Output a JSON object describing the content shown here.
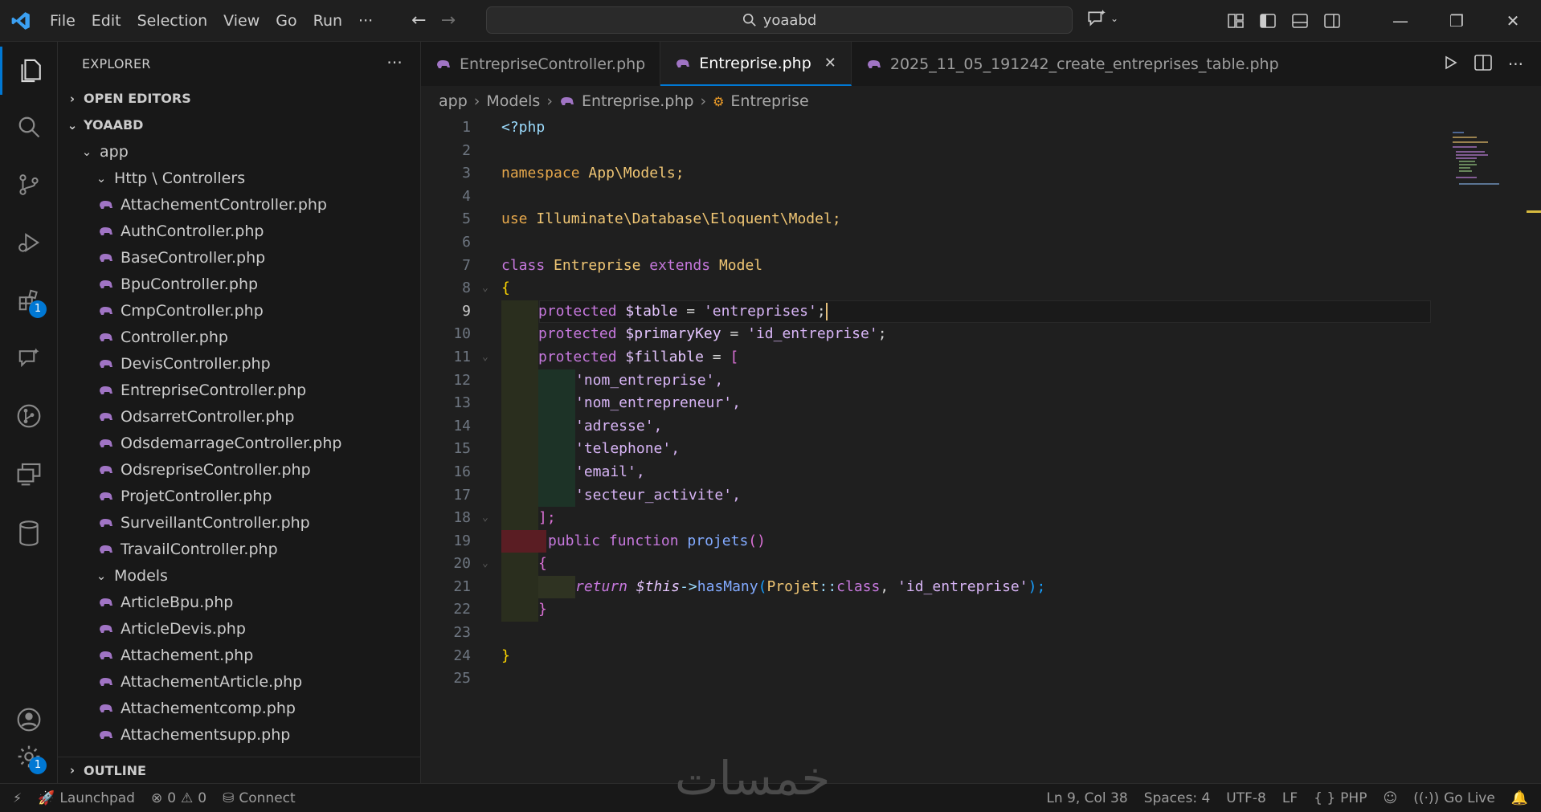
{
  "menu": [
    "File",
    "Edit",
    "Selection",
    "View",
    "Go",
    "Run",
    "···"
  ],
  "search": {
    "text": "yoaabd"
  },
  "explorer": {
    "title": "EXPLORER",
    "open_editors": "OPEN EDITORS",
    "root": "YOAABD",
    "app": "app",
    "http_controllers": "Http \\ Controllers",
    "controllers": [
      "AttachementController.php",
      "AuthController.php",
      "BaseController.php",
      "BpuController.php",
      "CmpController.php",
      "Controller.php",
      "DevisController.php",
      "EntrepriseController.php",
      "OdsarretController.php",
      "OdsdemarrageController.php",
      "OdsrepriseController.php",
      "ProjetController.php",
      "SurveillantController.php",
      "TravailController.php"
    ],
    "models": "Models",
    "model_files": [
      "ArticleBpu.php",
      "ArticleDevis.php",
      "Attachement.php",
      "AttachementArticle.php",
      "Attachementcomp.php",
      "Attachementsupp.php"
    ],
    "outline": "OUTLINE"
  },
  "activity": {
    "extensions_badge": "1",
    "settings_badge": "1"
  },
  "tabs": [
    {
      "label": "EntrepriseController.php"
    },
    {
      "label": "Entreprise.php",
      "close": "✕"
    },
    {
      "label": "2025_11_05_191242_create_entreprises_table.php"
    }
  ],
  "breadcrumb": [
    "app",
    "Models",
    "Entreprise.php",
    "Entreprise"
  ],
  "code": {
    "l1": "<?php",
    "l3a": "namespace",
    "l3b": "App\\Models;",
    "l5a": "use",
    "l5b": "Illuminate\\Database\\Eloquent\\Model;",
    "l7a": "class",
    "l7b": "Entreprise",
    "l7c": "extends",
    "l7d": "Model",
    "l8": "{",
    "l9a": "protected",
    "l9b": "$table",
    "l9c": " = ",
    "l9d": "'entreprises'",
    "l9e": ";",
    "l10a": "protected",
    "l10b": "$primaryKey",
    "l10c": " = ",
    "l10d": "'id_entreprise'",
    "l10e": ";",
    "l11a": "protected",
    "l11b": "$fillable",
    "l11c": " = ",
    "l11d": "[",
    "l12": "'nom_entreprise',",
    "l13": "'nom_entrepreneur',",
    "l14": "'adresse',",
    "l15": "'telephone',",
    "l16": "'email',",
    "l17": "'secteur_activite',",
    "l18": "];",
    "l19a": "public",
    "l19b": "function",
    "l19c": "projets",
    "l19d": "()",
    "l20": "{",
    "l21a": "return",
    "l21b": "$this",
    "l21c": "->",
    "l21d": "hasMany",
    "l21e": "(",
    "l21f": "Projet",
    "l21g": "::",
    "l21h": "class",
    "l21i": ", ",
    "l21j": "'id_entreprise'",
    "l21k": ");",
    "l22": "}",
    "l24": "}"
  },
  "status": {
    "launchpad": "Launchpad",
    "errors": "0",
    "warnings": "0",
    "connect": "Connect",
    "position": "Ln 9, Col 38",
    "spaces": "Spaces: 4",
    "encoding": "UTF-8",
    "eol": "LF",
    "language": "PHP",
    "golive": "Go Live"
  },
  "watermark": "خمسات"
}
